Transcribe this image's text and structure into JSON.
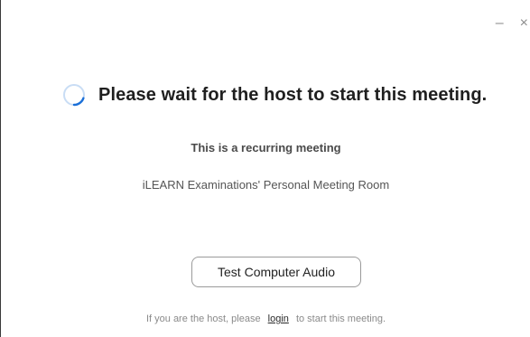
{
  "window": {
    "minimize_glyph": "–",
    "close_glyph": "×"
  },
  "status": {
    "spinner_icon": "loading-spinner-icon",
    "headline": "Please wait for the host to start this meeting."
  },
  "meeting": {
    "recurring_label": "This is a recurring meeting",
    "room_name": "iLEARN Examinations' Personal Meeting Room"
  },
  "actions": {
    "test_audio_label": "Test Computer Audio"
  },
  "footer": {
    "prefix": "If you are the host, please",
    "login_label": "login",
    "suffix": "to start this meeting."
  },
  "colors": {
    "spinner_track": "#c9ddf5",
    "spinner_arc": "#1a6fd8",
    "headline": "#1f1f1f",
    "muted_text": "#8a8a8a"
  }
}
